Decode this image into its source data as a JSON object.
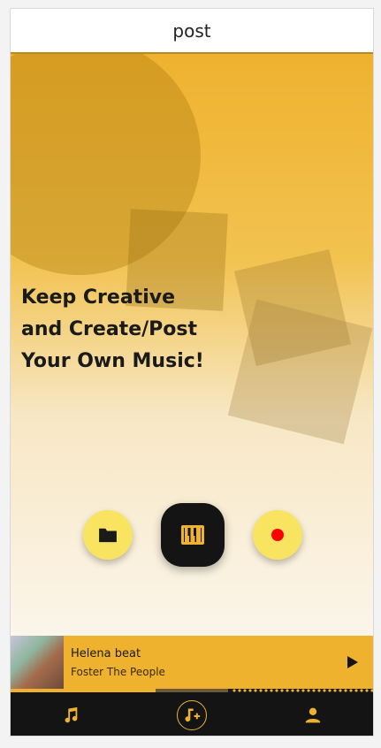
{
  "header": {
    "title": "post"
  },
  "hero": {
    "tagline_lines": [
      "Keep Creative",
      "and Create/Post",
      "Your Own Music!"
    ]
  },
  "actions": [
    {
      "name": "upload",
      "icon": "folder-icon"
    },
    {
      "name": "piano",
      "icon": "piano-icon"
    },
    {
      "name": "record",
      "icon": "record-icon"
    }
  ],
  "player": {
    "title": "Helena beat",
    "artist": "Foster The People",
    "progress": 0.4,
    "buffered": 0.6,
    "play_icon": "play-icon"
  },
  "nav": {
    "items": [
      {
        "name": "music",
        "icon": "music-note-icon"
      },
      {
        "name": "post",
        "icon": "add-music-icon",
        "active": true
      },
      {
        "name": "profile",
        "icon": "person-icon"
      }
    ]
  },
  "colors": {
    "accent": "#efb22f",
    "button_yellow": "#f8e461",
    "dark": "#141414",
    "record_red": "#ff0000"
  }
}
